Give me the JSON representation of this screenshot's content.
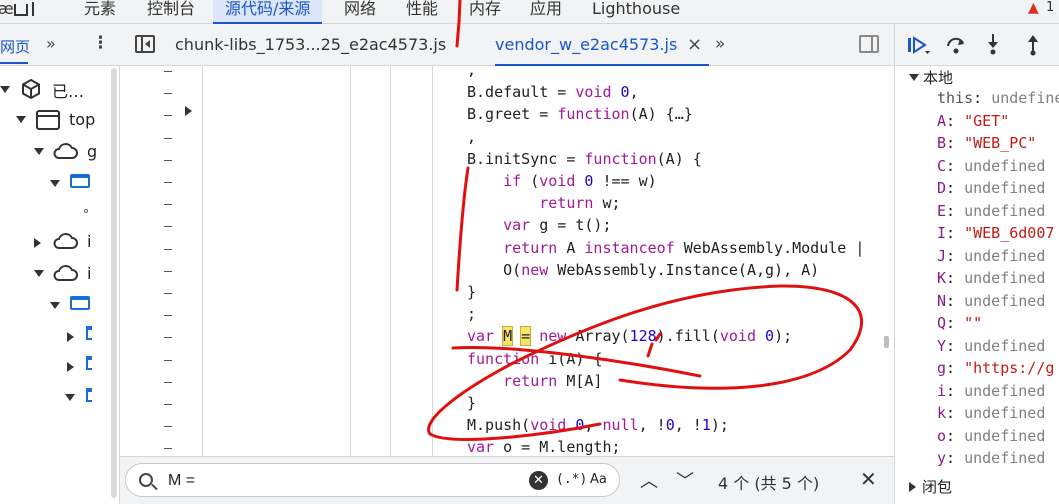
{
  "top_tabs": {
    "partial_left": "æ",
    "partial_left2": "元",
    "t1": "元素",
    "t2": "控制台",
    "t3": "源代码/来源",
    "t4": "网络",
    "t5": "性能",
    "t6": "内存",
    "t7": "应用",
    "t8": "Lighthouse",
    "warning_count": "1"
  },
  "navigator": {
    "title": "网页",
    "more": "»",
    "kebab": "⋮",
    "items": {
      "a": "已…",
      "b": "top",
      "c": "g",
      "d": "i",
      "e": "i"
    }
  },
  "file_tabs": {
    "tab1": "chunk-libs_1753...25_e2ac4573.js",
    "tab2": "vendor_w_e2ac4573.js",
    "close": "×",
    "more": "»"
  },
  "code": [
    {
      "segs": [
        {
          "t": ","
        }
      ]
    },
    {
      "segs": [
        {
          "t": "B.default = "
        },
        {
          "t": "void",
          "c": "kw"
        },
        {
          "t": " "
        },
        {
          "t": "0",
          "c": "num"
        },
        {
          "t": ","
        }
      ]
    },
    {
      "segs": [
        {
          "t": "B.greet = "
        },
        {
          "t": "function",
          "c": "kw"
        },
        {
          "t": "(A) {…}"
        }
      ]
    },
    {
      "segs": [
        {
          "t": ","
        }
      ]
    },
    {
      "segs": [
        {
          "t": "B.initSync = "
        },
        {
          "t": "function",
          "c": "kw"
        },
        {
          "t": "(A) {"
        }
      ]
    },
    {
      "segs": [
        {
          "t": "    "
        },
        {
          "t": "if",
          "c": "kw"
        },
        {
          "t": " ("
        },
        {
          "t": "void",
          "c": "kw"
        },
        {
          "t": " "
        },
        {
          "t": "0",
          "c": "num"
        },
        {
          "t": " !== w)"
        }
      ]
    },
    {
      "segs": [
        {
          "t": "        "
        },
        {
          "t": "return",
          "c": "kw"
        },
        {
          "t": " w;"
        }
      ]
    },
    {
      "segs": [
        {
          "t": "    "
        },
        {
          "t": "var",
          "c": "kw"
        },
        {
          "t": " g = t();"
        }
      ]
    },
    {
      "segs": [
        {
          "t": "    "
        },
        {
          "t": "return",
          "c": "kw"
        },
        {
          "t": " A "
        },
        {
          "t": "instanceof",
          "c": "kw"
        },
        {
          "t": " WebAssembly.Module |"
        }
      ]
    },
    {
      "segs": [
        {
          "t": "    O("
        },
        {
          "t": "new",
          "c": "kw"
        },
        {
          "t": " WebAssembly.Instance(A,g), A)"
        }
      ]
    },
    {
      "segs": [
        {
          "t": "}"
        }
      ]
    },
    {
      "segs": [
        {
          "t": ";"
        }
      ]
    },
    {
      "segs": [
        {
          "t": "var",
          "c": "kw"
        },
        {
          "t": " "
        },
        {
          "t": "M",
          "c": "hl"
        },
        {
          "t": " "
        },
        {
          "t": "=",
          "c": "hl"
        },
        {
          "t": " "
        },
        {
          "t": "new",
          "c": "kw"
        },
        {
          "t": " Array("
        },
        {
          "t": "128",
          "c": "num"
        },
        {
          "t": ").fill("
        },
        {
          "t": "void",
          "c": "kw"
        },
        {
          "t": " "
        },
        {
          "t": "0",
          "c": "num"
        },
        {
          "t": ");"
        }
      ]
    },
    {
      "segs": [
        {
          "t": "function",
          "c": "kw"
        },
        {
          "t": " i(A) {"
        }
      ]
    },
    {
      "segs": [
        {
          "t": "    "
        },
        {
          "t": "return",
          "c": "kw"
        },
        {
          "t": " M[A]"
        }
      ]
    },
    {
      "segs": [
        {
          "t": "}"
        }
      ]
    },
    {
      "segs": [
        {
          "t": "M.push("
        },
        {
          "t": "void",
          "c": "kw"
        },
        {
          "t": " "
        },
        {
          "t": "0",
          "c": "num"
        },
        {
          "t": ", "
        },
        {
          "t": "null",
          "c": "kw"
        },
        {
          "t": ", !"
        },
        {
          "t": "0",
          "c": "num"
        },
        {
          "t": ", !"
        },
        {
          "t": "1",
          "c": "num"
        },
        {
          "t": ");"
        }
      ]
    },
    {
      "segs": [
        {
          "t": "var",
          "c": "kw"
        },
        {
          "t": " o = M.length;"
        }
      ]
    }
  ],
  "search": {
    "value": "M =",
    "clear": "✕",
    "regex_label": "(.*)",
    "case_label": "Aa",
    "prev": "︿",
    "next": "﹀",
    "match_count": "4 个 (共 5 个)",
    "close": "✕"
  },
  "debugger": {
    "scope_title": "本地",
    "closure_title": "闭包",
    "vars": [
      {
        "k": "this",
        "v": "undefine",
        "kc": "plain",
        "vc": "undef"
      },
      {
        "k": "A",
        "v": "\"GET\"",
        "kc": "",
        "vc": "str"
      },
      {
        "k": "B",
        "v": "\"WEB_PC\"",
        "kc": "",
        "vc": "str"
      },
      {
        "k": "C",
        "v": "undefined",
        "kc": "",
        "vc": "undef"
      },
      {
        "k": "D",
        "v": "undefined",
        "kc": "",
        "vc": "undef"
      },
      {
        "k": "E",
        "v": "undefined",
        "kc": "",
        "vc": "undef"
      },
      {
        "k": "I",
        "v": "\"WEB_6d007",
        "kc": "",
        "vc": "str"
      },
      {
        "k": "J",
        "v": "undefined",
        "kc": "",
        "vc": "undef"
      },
      {
        "k": "K",
        "v": "undefined",
        "kc": "",
        "vc": "undef"
      },
      {
        "k": "N",
        "v": "undefined",
        "kc": "",
        "vc": "undef"
      },
      {
        "k": "Q",
        "v": "\"\"",
        "kc": "",
        "vc": "str"
      },
      {
        "k": "Y",
        "v": "undefined",
        "kc": "",
        "vc": "undef"
      },
      {
        "k": "g",
        "v": "\"https://g",
        "kc": "",
        "vc": "str"
      },
      {
        "k": "i",
        "v": "undefined",
        "kc": "",
        "vc": "undef"
      },
      {
        "k": "k",
        "v": "undefined",
        "kc": "",
        "vc": "undef"
      },
      {
        "k": "o",
        "v": "undefined",
        "kc": "",
        "vc": "undef"
      },
      {
        "k": "y",
        "v": "undefined",
        "kc": "",
        "vc": "undef"
      }
    ]
  },
  "colors": {
    "accent": "#1a56c8",
    "keyword": "#a0199b",
    "string": "#c41a16",
    "annotation": "#e01010"
  }
}
